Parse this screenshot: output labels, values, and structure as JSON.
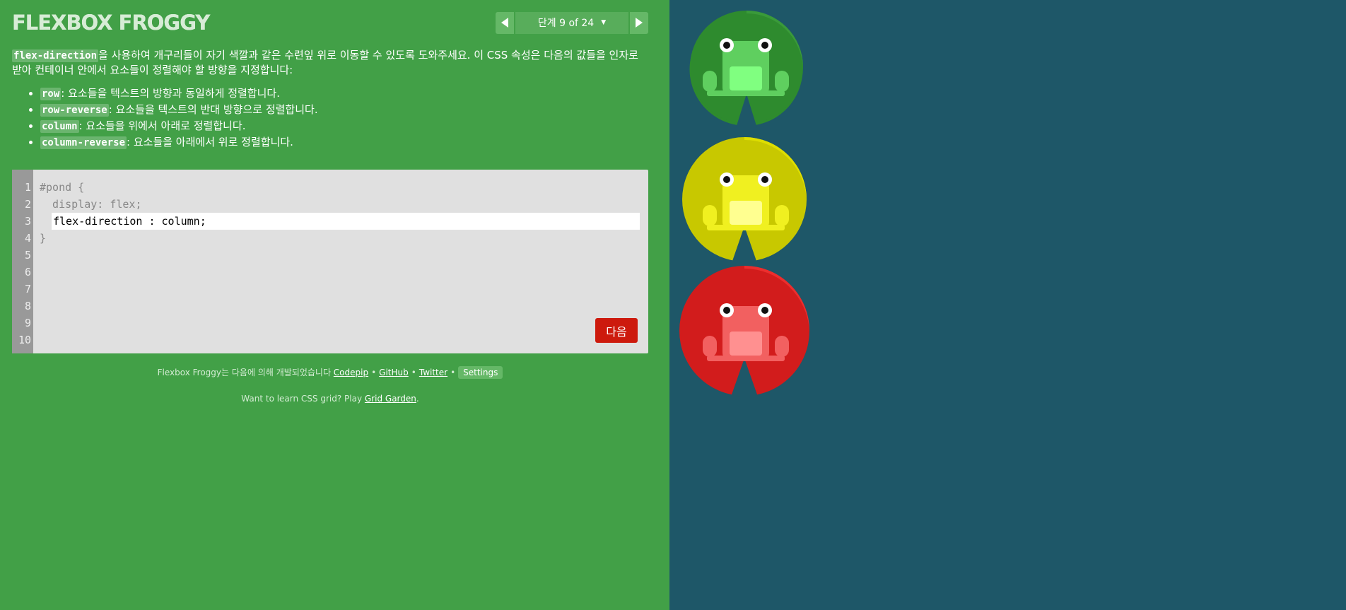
{
  "header": {
    "title": "FLEXBOX FROGGY",
    "level_label": "단계 9 of 24",
    "caret": "▼"
  },
  "instructions": {
    "intro_keyword": "flex-direction",
    "intro_text": "을 사용하여 개구리들이 자기 색깔과 같은 수련잎 위로 이동할 수 있도록 도와주세요. 이 CSS 속성은 다음의 값들을 인자로 받아 컨테이너 안에서 요소들이 정렬해야 할 방향을 지정합니다:",
    "items": [
      {
        "keyword": "row",
        "text": ": 요소들을 텍스트의 방향과 동일하게 정렬합니다."
      },
      {
        "keyword": "row-reverse",
        "text": ": 요소들을 텍스트의 반대 방향으로 정렬합니다."
      },
      {
        "keyword": "column",
        "text": ": 요소들을 위에서 아래로 정렬합니다."
      },
      {
        "keyword": "column-reverse",
        "text": ": 요소들을 아래에서 위로 정렬합니다."
      }
    ]
  },
  "editor": {
    "line_numbers": [
      "1",
      "2",
      "3",
      "4",
      "5",
      "6",
      "7",
      "8",
      "9",
      "10"
    ],
    "line1": "#pond {",
    "line2": "  display: flex;",
    "input_value": "flex-direction : column;",
    "line4": "}",
    "next_button": "다음"
  },
  "footer": {
    "credit_prefix": "Flexbox Froggy는 다음에 의해 개발되었습니다 ",
    "codepip": "Codepip",
    "github": "GitHub",
    "twitter": "Twitter",
    "bullet": "•",
    "settings": "Settings",
    "learn_prefix": "Want to learn CSS grid? Play ",
    "grid_garden": "Grid Garden",
    "learn_suffix": "."
  },
  "colors": {
    "sidebar_bg": "#42a047",
    "pond_bg": "#1e5768",
    "green": "#2e8b2e",
    "yellow": "#d4d400",
    "red": "#d21c1c"
  },
  "pond": {
    "lilypads": [
      {
        "color": "green",
        "icon": "lilypad-icon"
      },
      {
        "color": "yellow",
        "icon": "lilypad-icon"
      },
      {
        "color": "red",
        "icon": "lilypad-icon"
      }
    ],
    "frogs": [
      {
        "color": "green",
        "icon": "frog-icon"
      },
      {
        "color": "yellow",
        "icon": "frog-icon"
      },
      {
        "color": "red",
        "icon": "frog-icon"
      }
    ]
  }
}
